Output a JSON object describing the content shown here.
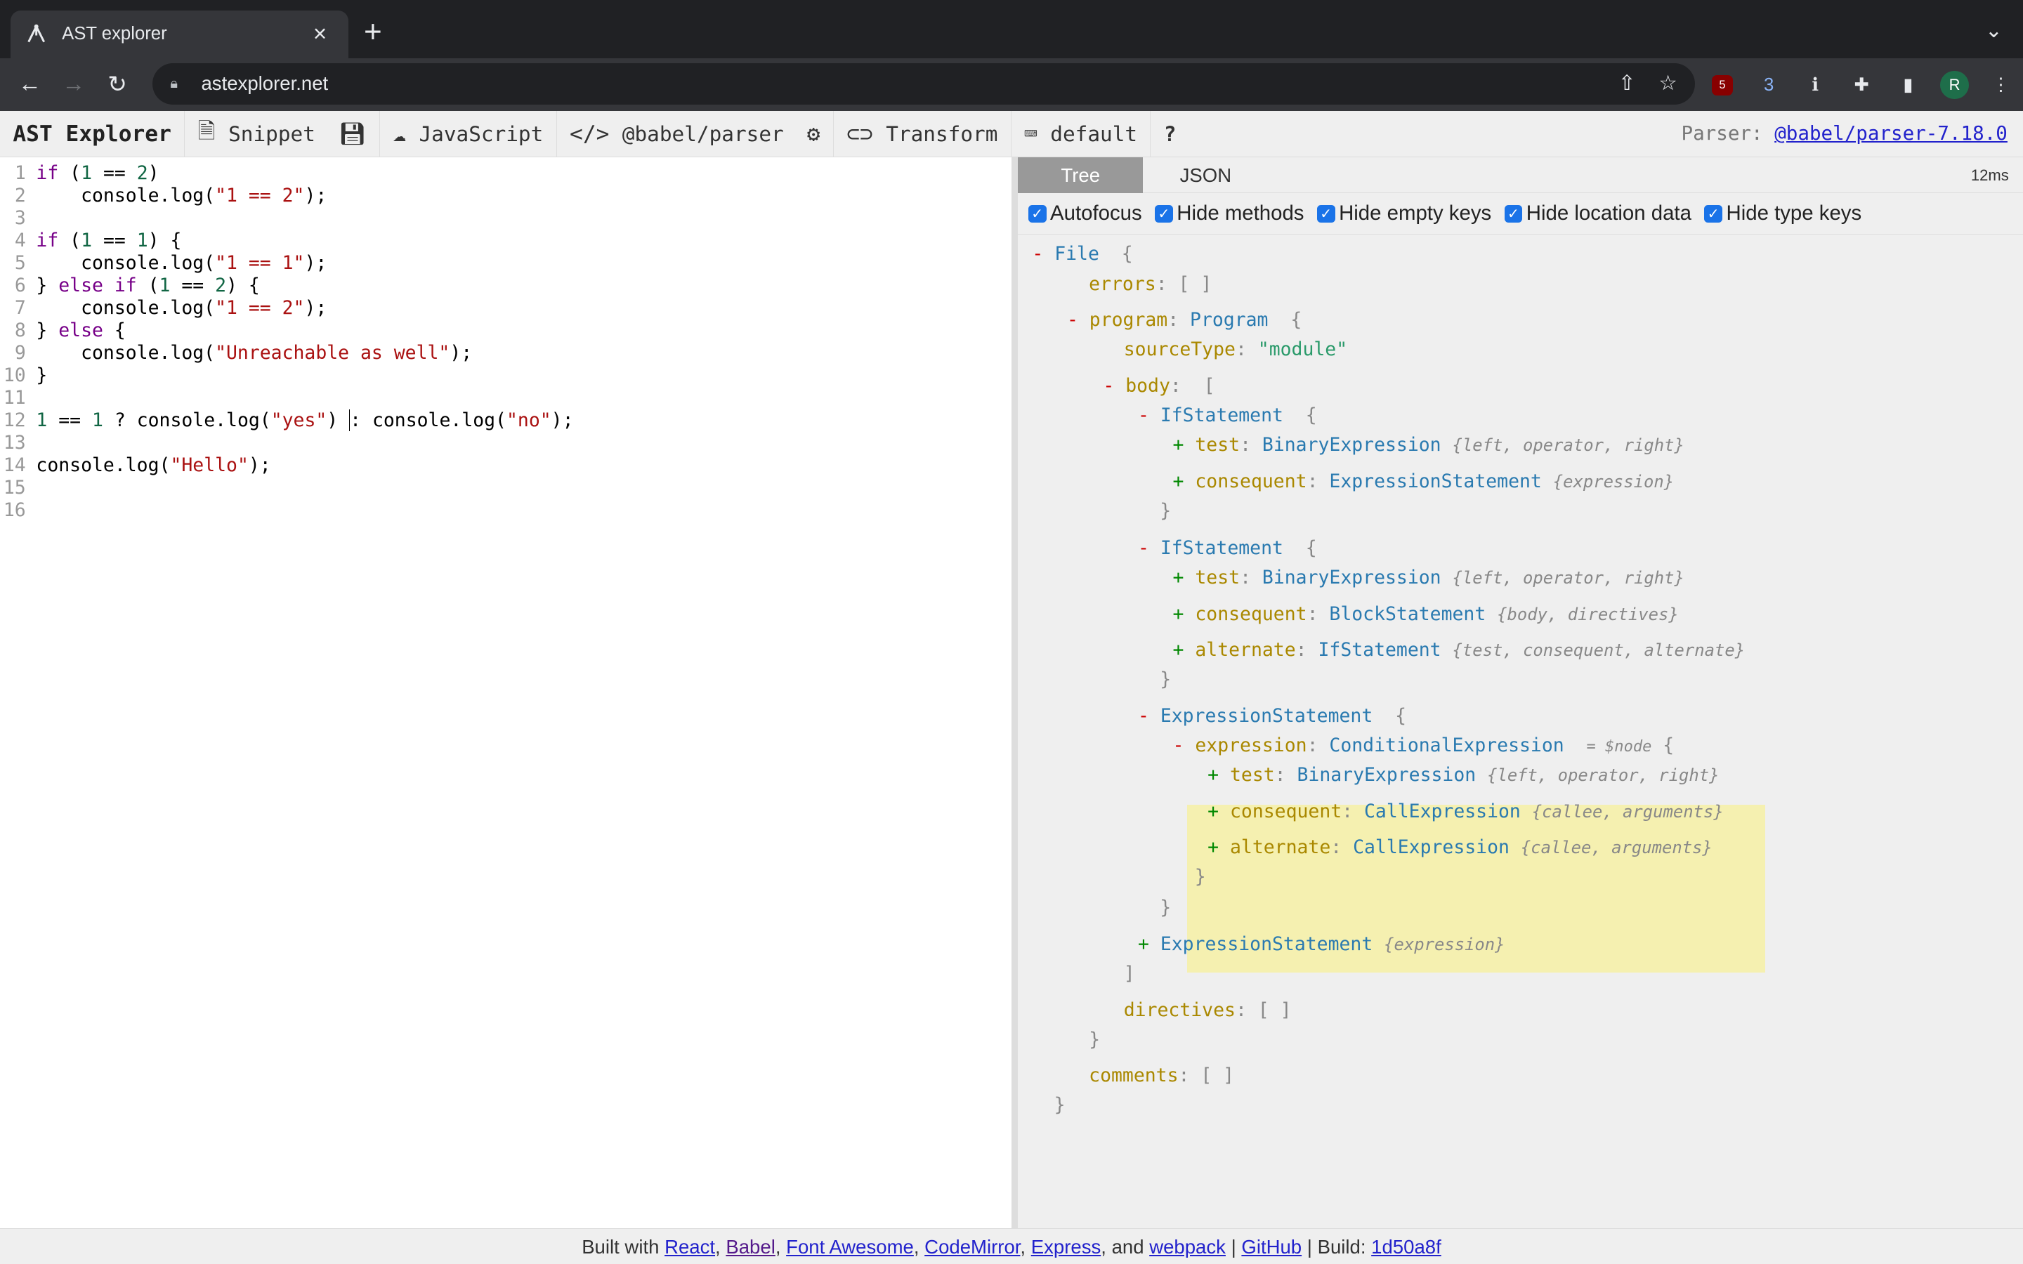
{
  "browser": {
    "tab_title": "AST explorer",
    "url": "astexplorer.net",
    "ext_ub_badge": "5",
    "ext_2_badge": "3",
    "avatar": "R"
  },
  "header": {
    "logo": "AST Explorer",
    "snippet": "Snippet",
    "language": "JavaScript",
    "parser": "@babel/parser",
    "transform": "Transform",
    "keymap": "default",
    "help": "?",
    "parser_label": "Parser:",
    "parser_version": "@babel/parser-7.18.0"
  },
  "editor": {
    "lines": [
      "1",
      "2",
      "3",
      "4",
      "5",
      "6",
      "7",
      "8",
      "9",
      "10",
      "11",
      "12",
      "13",
      "14",
      "15",
      "16"
    ]
  },
  "output": {
    "tabs": [
      "Tree",
      "JSON"
    ],
    "timing": "12ms",
    "options": [
      "Autofocus",
      "Hide methods",
      "Hide empty keys",
      "Hide location data",
      "Hide type keys"
    ]
  },
  "footer": {
    "built_with": "Built with",
    "links": [
      "React",
      "Babel",
      "Font Awesome",
      "CodeMirror",
      "Express",
      "webpack",
      "GitHub",
      "1d50a8f"
    ],
    "and": "and",
    "build": "Build:"
  }
}
